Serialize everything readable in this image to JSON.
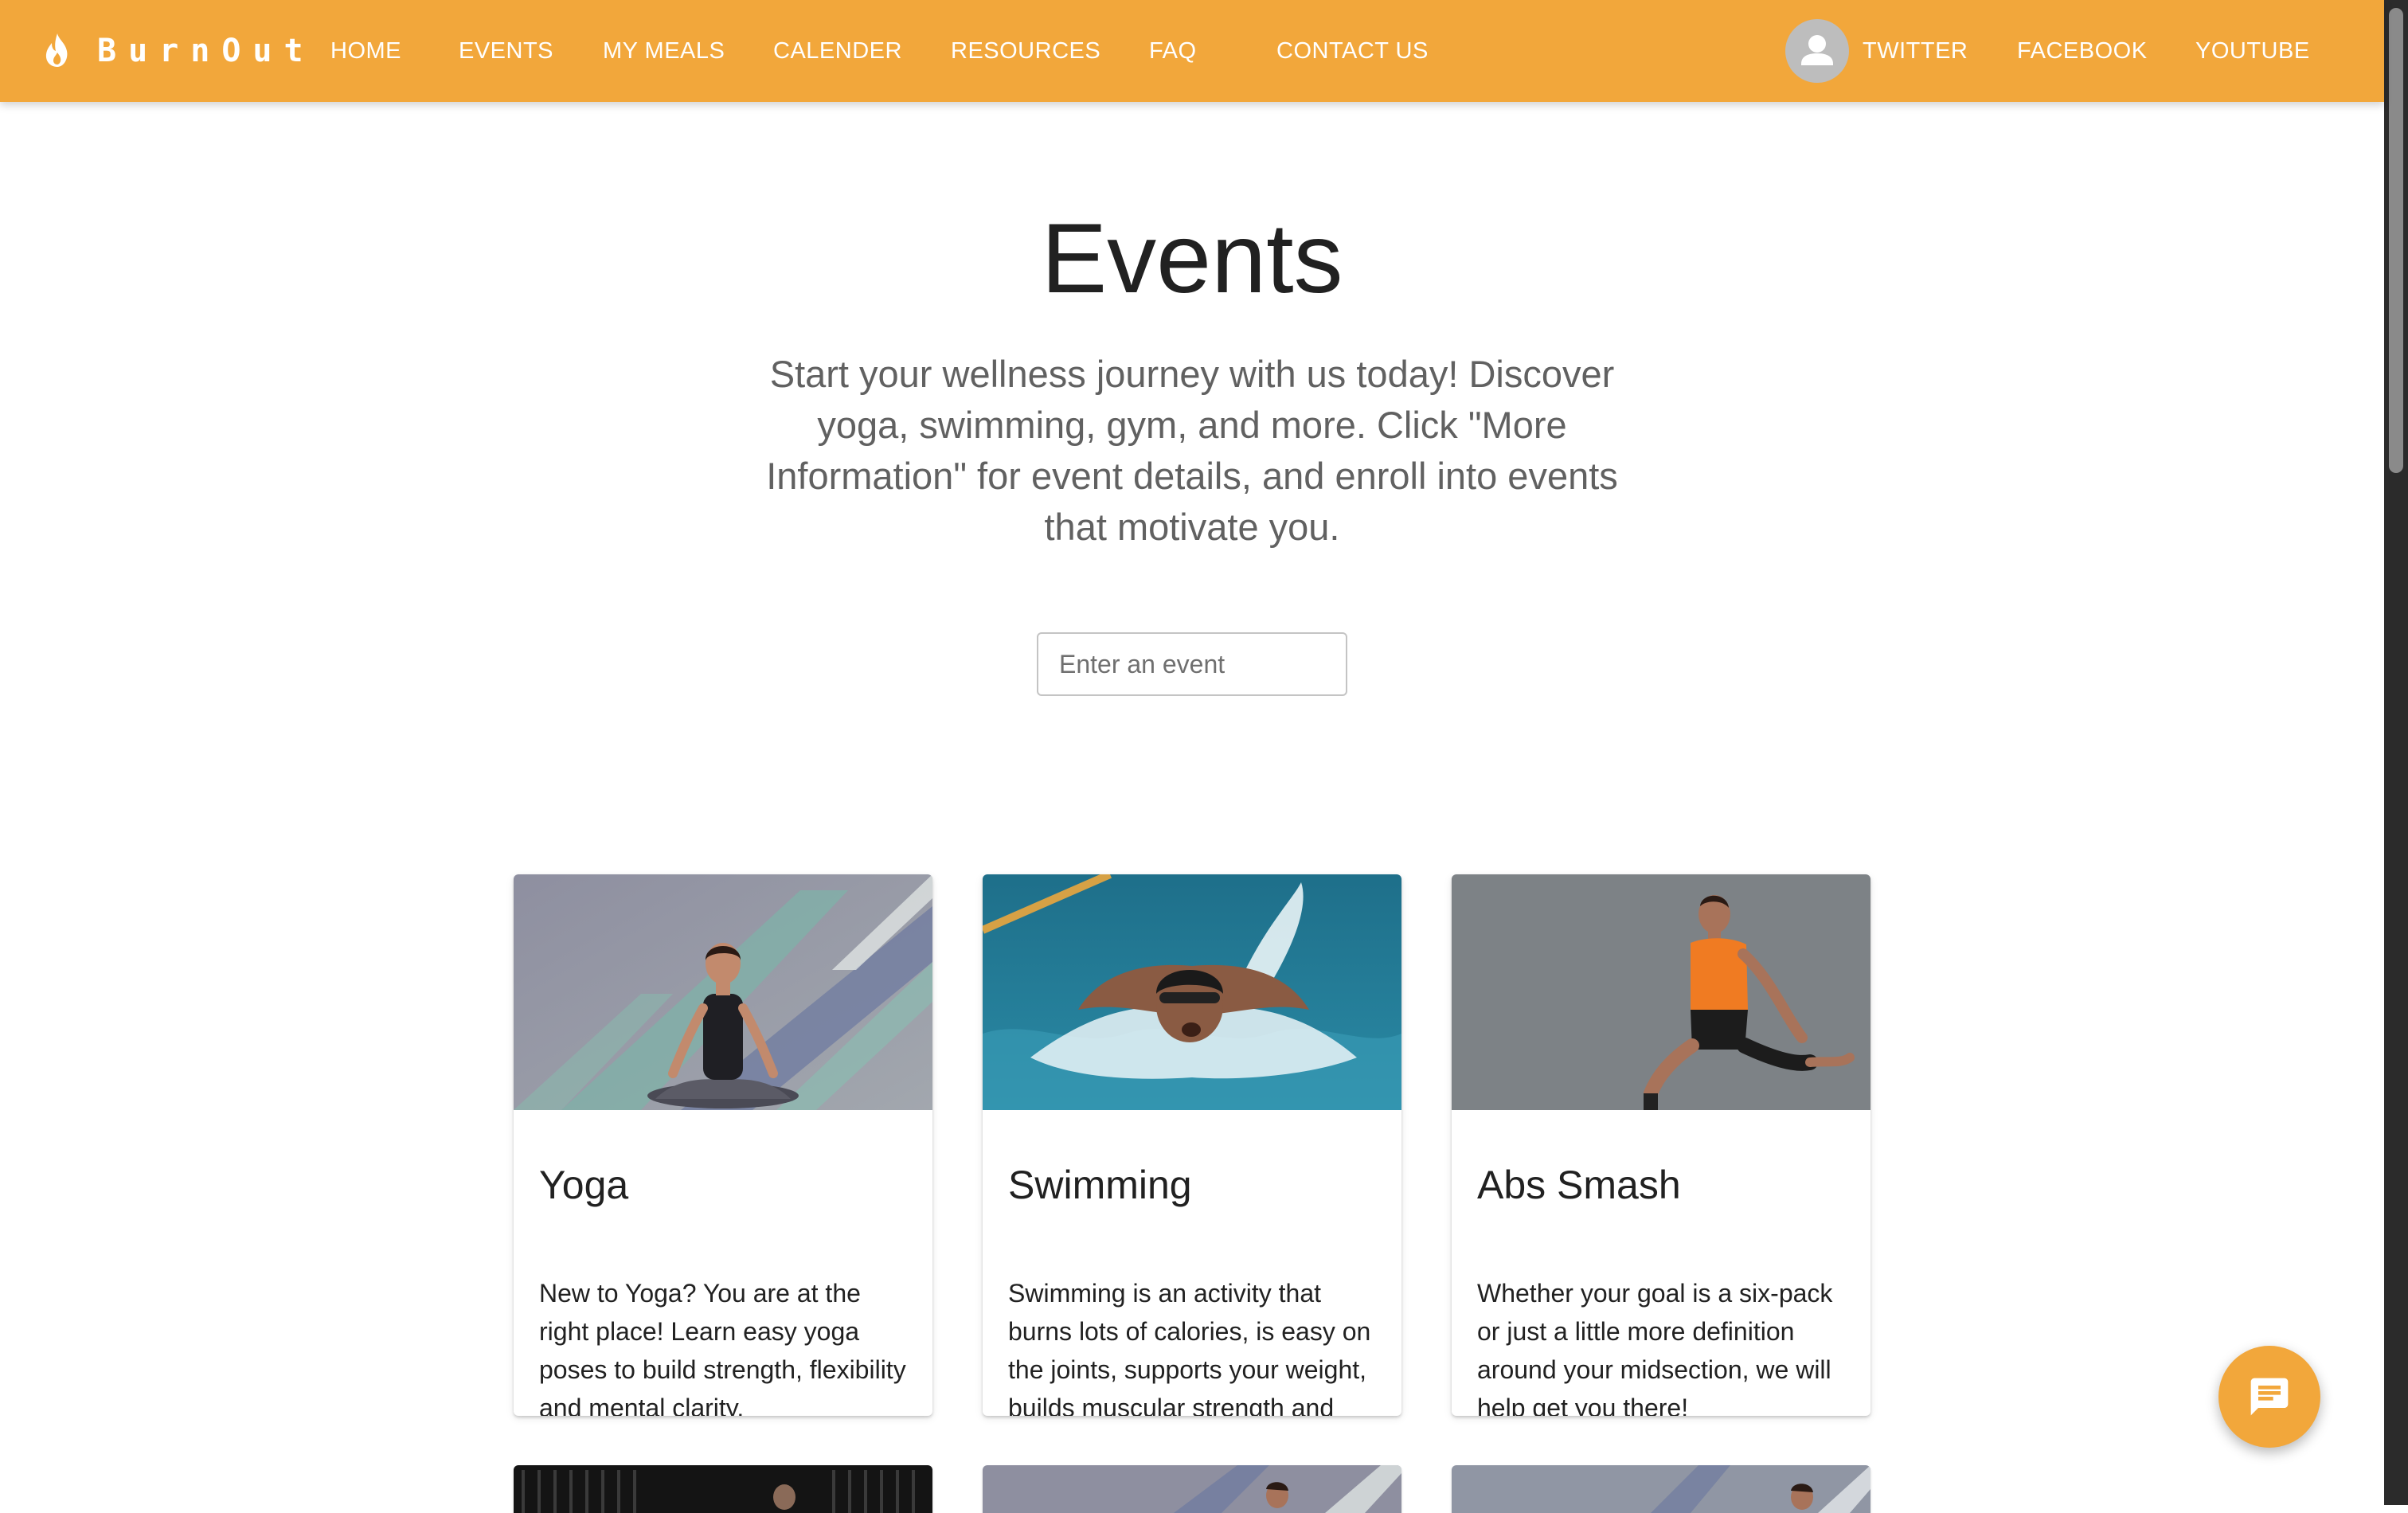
{
  "brand": {
    "name": "BurnOut",
    "logo_icon": "flame-icon"
  },
  "nav": {
    "links": [
      "HOME",
      "EVENTS",
      "MY MEALS",
      "CALENDER",
      "RESOURCES",
      "FAQ",
      "CONTACT US"
    ],
    "avatar_icon": "account-icon",
    "social": [
      "TWITTER",
      "FACEBOOK",
      "YOUTUBE"
    ]
  },
  "hero": {
    "title": "Events",
    "intro": "Start your wellness journey with us today! Discover yoga, swimming, gym, and more. Click \"More Information\" for event details, and enroll into events that motivate you.",
    "search_placeholder": "Enter an event"
  },
  "cards": [
    {
      "title": "Yoga",
      "description": "New to Yoga? You are at the right place! Learn easy yoga poses to build strength, flexibility and mental clarity."
    },
    {
      "title": "Swimming",
      "description": "Swimming is an activity that burns lots of calories, is easy on the joints, supports your weight, builds muscular strength and endurance."
    },
    {
      "title": "Abs Smash",
      "description": "Whether your goal is a six-pack or just a little more definition around your midsection, we will help get you there!"
    }
  ],
  "chat_fab": {
    "icon": "chat-icon"
  },
  "colors": {
    "primary": "#f2a73b",
    "text": "#212121",
    "muted": "#616161"
  }
}
